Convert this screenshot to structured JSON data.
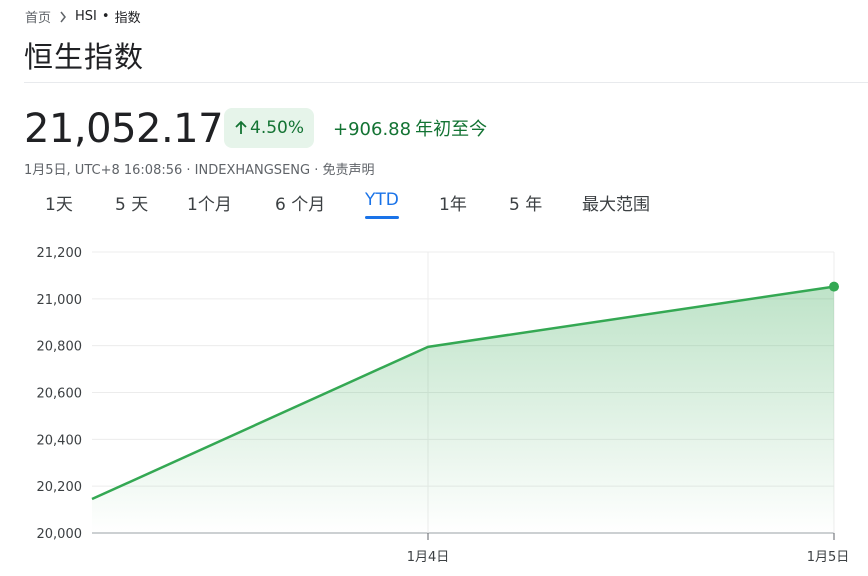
{
  "breadcrumb": {
    "home": "首页",
    "symbol": "HSI",
    "dot": "•",
    "section": "指数"
  },
  "title": "恒生指数",
  "quote": {
    "price": "21,052.17",
    "percent": "4.50%",
    "change": "+906.88",
    "period": "年初至今",
    "meta": "1月5日, UTC+8 16:08:56 · INDEXHANGSENG · 免责声明"
  },
  "tabs": [
    {
      "label": "1天"
    },
    {
      "label": "5 天"
    },
    {
      "label": "1个月"
    },
    {
      "label": "6 个月"
    },
    {
      "label": "YTD",
      "active": true
    },
    {
      "label": "1年"
    },
    {
      "label": "5 年"
    },
    {
      "label": "最大范围"
    }
  ],
  "colors": {
    "up": "#137333",
    "line": "#34a853",
    "accent": "#1a73e8"
  },
  "chart_data": {
    "type": "area",
    "x": [
      "",
      "1月4日",
      "1月5日"
    ],
    "y": [
      20145,
      20795,
      21052.17
    ],
    "xticks": [
      "1月4日",
      "1月5日"
    ],
    "yticks": [
      "20,000",
      "20,200",
      "20,400",
      "20,600",
      "20,800",
      "21,000",
      "21,200"
    ],
    "ylim": [
      20000,
      21200
    ],
    "grid": true
  }
}
